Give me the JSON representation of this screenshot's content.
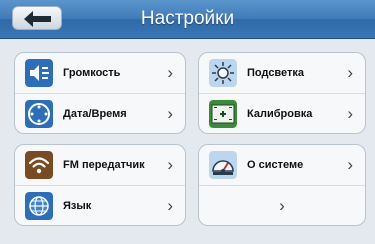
{
  "header": {
    "title": "Настройки",
    "back_icon": "arrow-left-icon"
  },
  "panels": [
    {
      "top": {
        "label": "Громкость",
        "icon": "speaker-icon",
        "chevron": "›"
      },
      "bottom": {
        "label": "Дата/Время",
        "icon": "clock-icon",
        "chevron": "›"
      }
    },
    {
      "top": {
        "label": "Подсветка",
        "icon": "backlight-sun-icon",
        "chevron": "›"
      },
      "bottom": {
        "label": "Калибровка",
        "icon": "calibration-icon",
        "chevron": "›"
      }
    },
    {
      "top": {
        "label": "FM передатчик",
        "icon": "fm-wireless-icon",
        "chevron": "›"
      },
      "bottom": {
        "label": "Язык",
        "icon": "globe-icon",
        "chevron": "›"
      }
    },
    {
      "top": {
        "label": "О системе",
        "icon": "system-info-icon",
        "chevron": "›"
      },
      "bottom": {
        "label": "",
        "icon": "",
        "chevron": "›"
      }
    }
  ],
  "colors": {
    "header": "#3f7bb9",
    "background": "#e3e9ee",
    "panel": "#f6f8fa"
  }
}
